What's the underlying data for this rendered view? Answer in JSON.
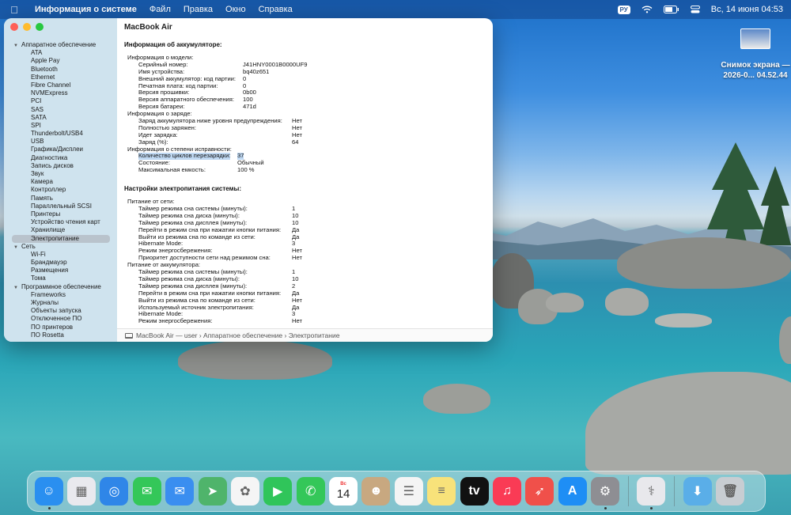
{
  "menubar": {
    "apple_icon": "apple-icon",
    "app_name": "Информация о системе",
    "menus": [
      "Файл",
      "Правка",
      "Окно",
      "Справка"
    ],
    "input_lang": "РУ",
    "datetime": "Вс, 14 июня  04:53"
  },
  "desktop_file": {
    "name_line1": "Снимок экрана —",
    "name_line2": "2026-0... 04.52.44"
  },
  "sidebar": {
    "items": [
      {
        "label": "Аппаратное обеспечение",
        "type": "group"
      },
      {
        "label": "ATA",
        "type": "child"
      },
      {
        "label": "Apple Pay",
        "type": "child"
      },
      {
        "label": "Bluetooth",
        "type": "child"
      },
      {
        "label": "Ethernet",
        "type": "child"
      },
      {
        "label": "Fibre Channel",
        "type": "child"
      },
      {
        "label": "NVMExpress",
        "type": "child"
      },
      {
        "label": "PCI",
        "type": "child"
      },
      {
        "label": "SAS",
        "type": "child"
      },
      {
        "label": "SATA",
        "type": "child"
      },
      {
        "label": "SPI",
        "type": "child"
      },
      {
        "label": "Thunderbolt/USB4",
        "type": "child"
      },
      {
        "label": "USB",
        "type": "child"
      },
      {
        "label": "Графика/Дисплеи",
        "type": "child"
      },
      {
        "label": "Диагностика",
        "type": "child"
      },
      {
        "label": "Запись дисков",
        "type": "child"
      },
      {
        "label": "Звук",
        "type": "child"
      },
      {
        "label": "Камера",
        "type": "child"
      },
      {
        "label": "Контроллер",
        "type": "child"
      },
      {
        "label": "Память",
        "type": "child"
      },
      {
        "label": "Параллельный SCSI",
        "type": "child"
      },
      {
        "label": "Принтеры",
        "type": "child"
      },
      {
        "label": "Устройство чтения карт",
        "type": "child"
      },
      {
        "label": "Хранилище",
        "type": "child"
      },
      {
        "label": "Электропитание",
        "type": "child",
        "selected": true
      },
      {
        "label": "Сеть",
        "type": "group"
      },
      {
        "label": "Wi-Fi",
        "type": "child"
      },
      {
        "label": "Брандмауэр",
        "type": "child"
      },
      {
        "label": "Размещения",
        "type": "child"
      },
      {
        "label": "Тома",
        "type": "child"
      },
      {
        "label": "Программное обеспечение",
        "type": "group"
      },
      {
        "label": "Frameworks",
        "type": "child"
      },
      {
        "label": "Журналы",
        "type": "child"
      },
      {
        "label": "Объекты запуска",
        "type": "child"
      },
      {
        "label": "Отключенное ПО",
        "type": "child"
      },
      {
        "label": "ПО принтеров",
        "type": "child"
      },
      {
        "label": "ПО Rosetta",
        "type": "child"
      }
    ]
  },
  "main": {
    "title": "MacBook Air",
    "battery_section_title": "Информация об аккумуляторе:",
    "battery_rows": [
      {
        "level": 1,
        "key": "Информация о модели:",
        "value": ""
      },
      {
        "level": 2,
        "key": "Серийный номер:",
        "value": "J41HNY0001B0000UF9",
        "col": "a"
      },
      {
        "level": 2,
        "key": "Имя устройства:",
        "value": "bq40z651",
        "col": "a"
      },
      {
        "level": 2,
        "key": "Внешний аккумулятор: код партии:",
        "value": "0",
        "col": "a"
      },
      {
        "level": 2,
        "key": "Печатная плата: код партии:",
        "value": "0",
        "col": "a"
      },
      {
        "level": 2,
        "key": "Версия прошивки:",
        "value": "0b00",
        "col": "a"
      },
      {
        "level": 2,
        "key": "Версия аппаратного обеспечения:",
        "value": "100",
        "col": "a"
      },
      {
        "level": 2,
        "key": "Версия батареи:",
        "value": "471d",
        "col": "a"
      },
      {
        "level": 1,
        "key": "Информация о заряде:",
        "value": ""
      },
      {
        "level": 2,
        "key": "Заряд аккумулятора ниже уровня предупреждения:",
        "value": "Нет",
        "col": "b"
      },
      {
        "level": 2,
        "key": "Полностью заряжен:",
        "value": "Нет",
        "col": "b"
      },
      {
        "level": 2,
        "key": "Идет зарядка:",
        "value": "Нет",
        "col": "b"
      },
      {
        "level": 2,
        "key": "Заряд (%):",
        "value": "64",
        "col": "b"
      },
      {
        "level": 1,
        "key": "Информация о степени исправности:",
        "value": ""
      },
      {
        "level": 2,
        "key": "Количество циклов перезарядки:",
        "value": "37",
        "col": "c",
        "highlight": true
      },
      {
        "level": 2,
        "key": "Состояние:",
        "value": "Обычный",
        "col": "c"
      },
      {
        "level": 2,
        "key": "Максимальная емкость:",
        "value": "100 %",
        "col": "c"
      }
    ],
    "power_section_title": "Настройки электропитания системы:",
    "power_rows": [
      {
        "level": 1,
        "key": "Питание от сети:",
        "value": ""
      },
      {
        "level": 2,
        "key": "Таймер режима сна системы (минуты):",
        "value": "1"
      },
      {
        "level": 2,
        "key": "Таймер режима сна диска (минуты):",
        "value": "10"
      },
      {
        "level": 2,
        "key": "Таймер режима сна дисплея (минуты):",
        "value": "10"
      },
      {
        "level": 2,
        "key": "Перейти в режим сна при нажатии кнопки питания:",
        "value": "Да"
      },
      {
        "level": 2,
        "key": "Выйти из режима сна по команде из сети:",
        "value": "Да"
      },
      {
        "level": 2,
        "key": "Hibernate Mode:",
        "value": "3"
      },
      {
        "level": 2,
        "key": "Режим энергосбережения:",
        "value": "Нет"
      },
      {
        "level": 2,
        "key": "Приоритет доступности сети над режимом сна:",
        "value": "Нет"
      },
      {
        "level": 1,
        "key": "Питание от аккумулятора:",
        "value": ""
      },
      {
        "level": 2,
        "key": "Таймер режима сна системы (минуты):",
        "value": "1"
      },
      {
        "level": 2,
        "key": "Таймер режима сна диска (минуты):",
        "value": "10"
      },
      {
        "level": 2,
        "key": "Таймер режима сна дисплея (минуты):",
        "value": "2"
      },
      {
        "level": 2,
        "key": "Перейти в режим сна при нажатии кнопки питания:",
        "value": "Да"
      },
      {
        "level": 2,
        "key": "Выйти из режима сна по команде из сети:",
        "value": "Нет"
      },
      {
        "level": 2,
        "key": "Используемый источник электропитания:",
        "value": "Да"
      },
      {
        "level": 2,
        "key": "Hibernate Mode:",
        "value": "3"
      },
      {
        "level": 2,
        "key": "Режим энергосбережения:",
        "value": "Нет"
      },
      {
        "level": 2,
        "key": "Приоритет доступности сети над режимом сна:",
        "value": "Нет"
      }
    ]
  },
  "statusbar": {
    "path": "MacBook Air — user › Аппаратное обеспечение › Электропитание"
  },
  "dock": {
    "calendar_month": "Вс",
    "calendar_day": "14",
    "apps": [
      {
        "name": "finder-icon",
        "color": "#2a8ff0",
        "glyph": "☺",
        "running": true
      },
      {
        "name": "launchpad-icon",
        "color": "#e9e9ee",
        "glyph": "▦"
      },
      {
        "name": "safari-icon",
        "color": "#2f86e8",
        "glyph": "◎"
      },
      {
        "name": "messages-icon",
        "color": "#34c759",
        "glyph": "✉"
      },
      {
        "name": "mail-icon",
        "color": "#3a8ef0",
        "glyph": "✉"
      },
      {
        "name": "maps-icon",
        "color": "#4fb46b",
        "glyph": "➤"
      },
      {
        "name": "photos-icon",
        "color": "#f5f5f5",
        "glyph": "✿"
      },
      {
        "name": "facetime-icon",
        "color": "#30c55a",
        "glyph": "▶"
      },
      {
        "name": "phone-icon",
        "color": "#34c759",
        "glyph": "✆"
      },
      {
        "name": "calendar-icon",
        "color": "#ffffff",
        "glyph": ""
      },
      {
        "name": "contacts-icon",
        "color": "#c8a880",
        "glyph": "☻"
      },
      {
        "name": "reminders-icon",
        "color": "#f4f4f4",
        "glyph": "☰"
      },
      {
        "name": "notes-icon",
        "color": "#f8e27a",
        "glyph": "≡"
      },
      {
        "name": "appletv-icon",
        "color": "#111111",
        "glyph": "tv"
      },
      {
        "name": "music-icon",
        "color": "#fa3b55",
        "glyph": "♫"
      },
      {
        "name": "rocket-icon",
        "color": "#f0504a",
        "glyph": "➶"
      },
      {
        "name": "appstore-icon",
        "color": "#1e8ef5",
        "glyph": "A"
      },
      {
        "name": "settings-icon",
        "color": "#8e8e93",
        "glyph": "⚙",
        "running": true
      }
    ],
    "recent": [
      {
        "name": "system-information-icon",
        "color": "#e8e8ec",
        "glyph": "⚕",
        "running": true
      }
    ],
    "trailing": [
      {
        "name": "downloads-folder-icon",
        "color": "#5aaee8",
        "glyph": "⬇"
      },
      {
        "name": "trash-icon",
        "color": "#c8cdd2",
        "glyph": "🗑"
      }
    ]
  }
}
